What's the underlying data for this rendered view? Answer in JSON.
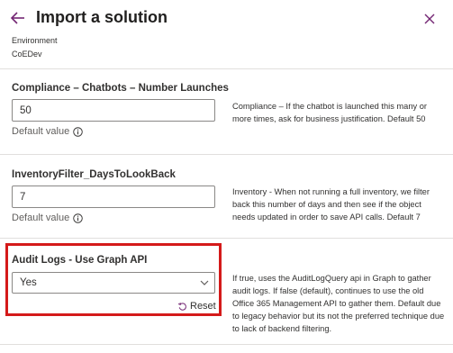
{
  "header": {
    "title": "Import a solution",
    "back_icon": "arrow-left-icon",
    "close_icon": "close-icon"
  },
  "environment": {
    "label": "Environment",
    "value": "CoEDev"
  },
  "fields": [
    {
      "label": "Compliance – Chatbots – Number Launches",
      "value": "50",
      "default_label": "Default value",
      "description": "Compliance – If the chatbot is launched this many or more times, ask for business justification. Default 50"
    },
    {
      "label": "InventoryFilter_DaysToLookBack",
      "value": "7",
      "default_label": "Default value",
      "description": "Inventory - When not running a full inventory, we filter back this number of days and then see if the object needs updated in order to save API calls. Default 7"
    },
    {
      "label": "Audit Logs - Use Graph API",
      "value": "Yes",
      "reset_label": "Reset",
      "description": "If true, uses the AuditLogQuery api in Graph to gather audit logs. If false (default), continues to use the old Office 365 Management API to gather them. Default due to legacy behavior but its not the preferred technique due to lack of backend filtering."
    }
  ],
  "colors": {
    "accent": "#742774",
    "highlight": "#d41a1a",
    "border": "#8a8886",
    "divider": "#e1dfdd"
  }
}
